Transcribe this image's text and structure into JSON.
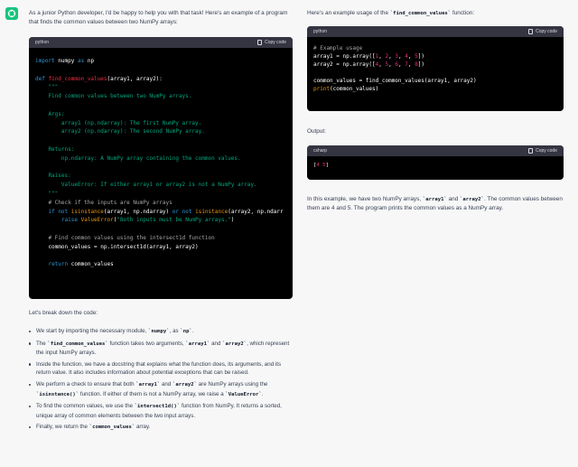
{
  "left": {
    "intro": "As a junior Python developer, I'd be happy to help you with that task! Here's an example of a program that finds the common values between two NumPy arrays:",
    "code_block": {
      "language": "python",
      "copy_label": "Copy code",
      "lines": [
        "import numpy as np",
        "",
        "def find_common_values(array1, array2):",
        "    \"\"\"",
        "    Find common values between two NumPy arrays.",
        "",
        "    Args:",
        "        array1 (np.ndarray): The first NumPy array.",
        "        array2 (np.ndarray): The second NumPy array.",
        "",
        "    Returns:",
        "        np.ndarray: A NumPy array containing the common values.",
        "",
        "    Raises:",
        "        ValueError: If either array1 or array2 is not a NumPy array.",
        "    \"\"\"",
        "    # Check if the inputs are NumPy arrays",
        "    if not isinstance(array1, np.ndarray) or not isinstance(array2, np.ndarr",
        "        raise ValueError(\"Both inputs must be NumPy arrays.\")",
        "",
        "    # Find common values using the intersect1d function",
        "    common_values = np.intersect1d(array1, array2)",
        "",
        "    return common_values"
      ]
    },
    "breakdown_intro": "Let's break down the code:",
    "bullets": [
      [
        "We start by importing the necessary module, ",
        {
          "code": "numpy"
        },
        ", as ",
        {
          "code": "np"
        },
        "."
      ],
      [
        "The ",
        {
          "code": "find_common_values"
        },
        " function takes two arguments, ",
        {
          "code": "array1"
        },
        " and ",
        {
          "code": "array2"
        },
        ", which represent the input NumPy arrays."
      ],
      [
        "Inside the function, we have a docstring that explains what the function does, its arguments, and its return value. It also includes information about potential exceptions that can be raised."
      ],
      [
        "We perform a check to ensure that both ",
        {
          "code": "array1"
        },
        " and ",
        {
          "code": "array2"
        },
        " are NumPy arrays using the ",
        {
          "code": "isinstance()"
        },
        " function. If either of them is not a NumPy array, we raise a ",
        {
          "code": "ValueError"
        },
        "."
      ],
      [
        "To find the common values, we use the ",
        {
          "code": "intersect1d()"
        },
        " function from NumPy. It returns a sorted, unique array of common elements between the two input arrays."
      ],
      [
        "Finally, we return the ",
        {
          "code": "common_values"
        },
        " array."
      ]
    ]
  },
  "right": {
    "intro_parts": [
      "Here's an example usage of the ",
      {
        "code": "find_common_values"
      },
      " function:"
    ],
    "usage_block": {
      "language": "python",
      "copy_label": "Copy code",
      "lines": [
        "# Example usage",
        "array1 = np.array([1, 2, 3, 4, 5])",
        "array2 = np.array([4, 5, 6, 7, 8])",
        "",
        "common_values = find_common_values(array1, array2)",
        "print(common_values)"
      ]
    },
    "output_label": "Output:",
    "output_block": {
      "language": "csharp",
      "copy_label": "Copy code",
      "lines": [
        "[4 5]"
      ]
    },
    "closing_parts": [
      "In this example, we have two NumPy arrays, ",
      {
        "code": "array1"
      },
      " and ",
      {
        "code": "array2"
      },
      ". The common values between them are 4 and 5. The program prints the common values as a NumPy array."
    ]
  }
}
